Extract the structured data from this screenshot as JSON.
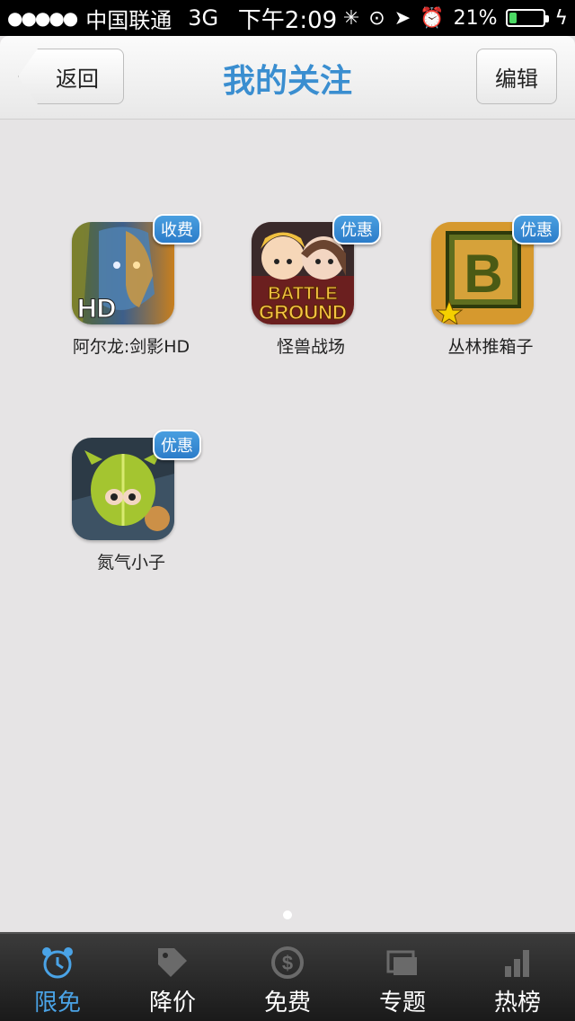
{
  "status_bar": {
    "signal": "●●●●●",
    "carrier": "中国联通",
    "network": "3G",
    "time": "下午2:09",
    "battery_percent": "21%",
    "battery_level": 0.21
  },
  "nav": {
    "back_label": "返回",
    "title": "我的关注",
    "edit_label": "编辑"
  },
  "apps": [
    {
      "name": "阿尔龙:剑影HD",
      "tag": "收费",
      "icon": "fantasy-warrior-icon"
    },
    {
      "name": "怪兽战场",
      "tag": "优惠",
      "icon": "battle-ground-icon"
    },
    {
      "name": "丛林推箱子",
      "tag": "优惠",
      "icon": "letter-b-crate-icon"
    },
    {
      "name": "氮气小子",
      "tag": "优惠",
      "icon": "green-creature-icon"
    }
  ],
  "app_icon_text": {
    "hd": "HD",
    "battle_line1": "BATTLE",
    "battle_line2": "GROUND",
    "b": "B"
  },
  "tabs": [
    {
      "label": "限免",
      "icon": "alarm-clock-icon",
      "active": true
    },
    {
      "label": "降价",
      "icon": "sale-tag-icon",
      "active": false
    },
    {
      "label": "免费",
      "icon": "dollar-coin-icon",
      "active": false
    },
    {
      "label": "专题",
      "icon": "stacked-cards-icon",
      "active": false
    },
    {
      "label": "热榜",
      "icon": "bar-chart-icon",
      "active": false
    }
  ],
  "colors": {
    "accent": "#3a8ed0",
    "tab_active": "#4aa3e6",
    "tag_blue": "#2b7cc9",
    "background": "#e6e4e5"
  }
}
